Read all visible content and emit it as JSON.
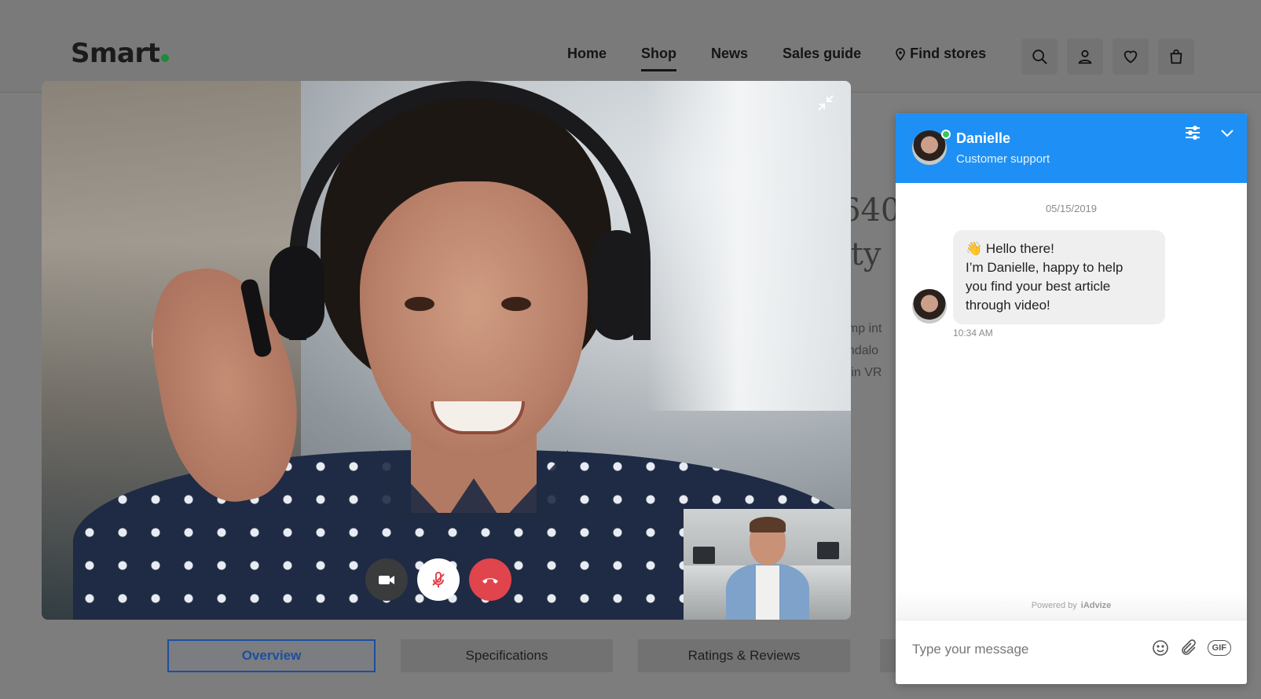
{
  "header": {
    "logo": "Smart",
    "nav": [
      {
        "label": "Home",
        "active": false
      },
      {
        "label": "Shop",
        "active": true
      },
      {
        "label": "News",
        "active": false
      },
      {
        "label": "Sales guide",
        "active": false
      },
      {
        "label": "Find stores",
        "active": false
      }
    ],
    "icons": [
      "search-icon",
      "user-icon",
      "heart-icon",
      "bag-icon"
    ]
  },
  "background_page": {
    "title_fragments": [
      "640",
      "ity"
    ],
    "desc_fragments": [
      "ump int",
      "andalo",
      "e in VR"
    ]
  },
  "video_call": {
    "controls": [
      "camera-icon",
      "mic-icon",
      "hang-up-icon"
    ],
    "colors": {
      "hangup": "#e0444c",
      "camera": "#3a3b3d"
    }
  },
  "tabs": [
    {
      "label": "Overview",
      "active": true
    },
    {
      "label": "Specifications",
      "active": false
    },
    {
      "label": "Ratings & Reviews",
      "active": false
    }
  ],
  "chat": {
    "agent_name": "Danielle",
    "agent_role": "Customer support",
    "date": "05/15/2019",
    "message": {
      "lines": [
        "👋 Hello there!",
        "I’m Danielle, happy to help",
        "you find your best article",
        "through video!"
      ],
      "time": "10:34 AM"
    },
    "powered_by": "Powered by",
    "brand": "iAdvize",
    "input_placeholder": "Type your message",
    "gif_label": "GIF",
    "accent_color": "#1e90f5"
  }
}
